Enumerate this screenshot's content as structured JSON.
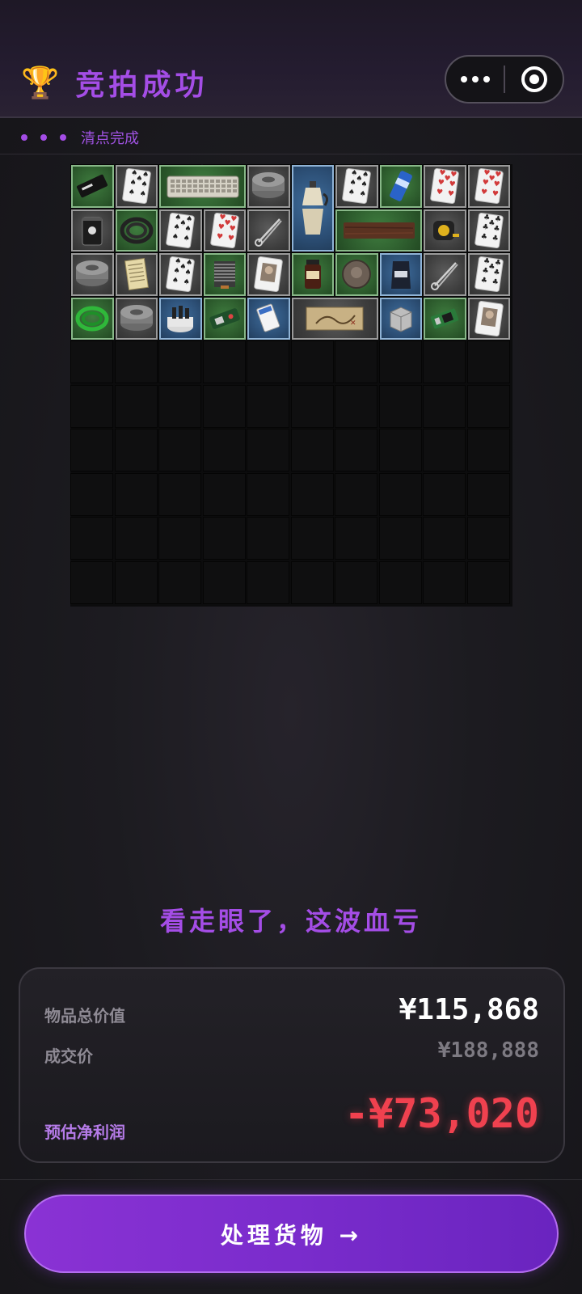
{
  "header": {
    "title": "竞拍成功",
    "trophy_icon": "trophy-icon",
    "more_icon": "more-dots-icon",
    "close_icon": "target-circle-icon"
  },
  "status": {
    "text": "清点完成"
  },
  "inventory": {
    "columns": 10,
    "rows": 10,
    "items": [
      {
        "name": "black-card-item",
        "rarity": "green"
      },
      {
        "name": "playing-card-spades-item",
        "rarity": "gray"
      },
      {
        "name": "keyboard-item",
        "rarity": "green"
      },
      {
        "name": "duct-tape-item",
        "rarity": "gray"
      },
      {
        "name": "moka-pot-item",
        "rarity": "blue"
      },
      {
        "name": "playing-card-spades-item",
        "rarity": "gray"
      },
      {
        "name": "energy-can-item",
        "rarity": "green"
      },
      {
        "name": "playing-card-hearts-item",
        "rarity": "gray"
      },
      {
        "name": "playing-card-hearts-item",
        "rarity": "gray"
      },
      {
        "name": "coffee-tin-item",
        "rarity": "gray"
      },
      {
        "name": "coiled-hose-item",
        "rarity": "green"
      },
      {
        "name": "playing-card-spades-item",
        "rarity": "gray"
      },
      {
        "name": "playing-card-hearts-item",
        "rarity": "gray"
      },
      {
        "name": "hemostat-item",
        "rarity": "gray"
      },
      {
        "name": "wooden-plank-item",
        "rarity": "green"
      },
      {
        "name": "tape-measure-item",
        "rarity": "gray"
      },
      {
        "name": "playing-card-clubs-item",
        "rarity": "gray"
      },
      {
        "name": "duct-tape-item",
        "rarity": "gray"
      },
      {
        "name": "document-item",
        "rarity": "gray"
      },
      {
        "name": "playing-card-spades-item",
        "rarity": "gray"
      },
      {
        "name": "cpu-cooler-item",
        "rarity": "green"
      },
      {
        "name": "playing-card-portrait-item",
        "rarity": "gray"
      },
      {
        "name": "spice-jar-item",
        "rarity": "green"
      },
      {
        "name": "coin-item",
        "rarity": "green"
      },
      {
        "name": "coffee-bag-item",
        "rarity": "blue"
      },
      {
        "name": "hemostat-item",
        "rarity": "gray"
      },
      {
        "name": "playing-card-clubs-item",
        "rarity": "gray"
      },
      {
        "name": "green-hose-item",
        "rarity": "green"
      },
      {
        "name": "duct-tape-item",
        "rarity": "gray"
      },
      {
        "name": "bottle-rack-item",
        "rarity": "blue"
      },
      {
        "name": "circuit-board-item",
        "rarity": "green"
      },
      {
        "name": "sd-card-item",
        "rarity": "blue"
      },
      {
        "name": "treasure-map-item",
        "rarity": "gray"
      },
      {
        "name": "metal-box-item",
        "rarity": "blue"
      },
      {
        "name": "green-chip-item",
        "rarity": "green"
      },
      {
        "name": "playing-card-portrait-item",
        "rarity": "gray"
      }
    ]
  },
  "verdict": "看走眼了，这波血亏",
  "summary": {
    "total_label": "物品总价值",
    "total_value": "¥115,868",
    "deal_label": "成交价",
    "deal_value": "¥188,888",
    "profit_label": "预估净利润",
    "profit_value": "-¥73,020"
  },
  "cta": {
    "label": "处理货物 →"
  },
  "colors": {
    "accent": "#a44de6",
    "loss": "#f0414f",
    "rarity_gray": "#4a4a4a",
    "rarity_green": "#2f6a2f",
    "rarity_blue": "#2e5a88"
  }
}
